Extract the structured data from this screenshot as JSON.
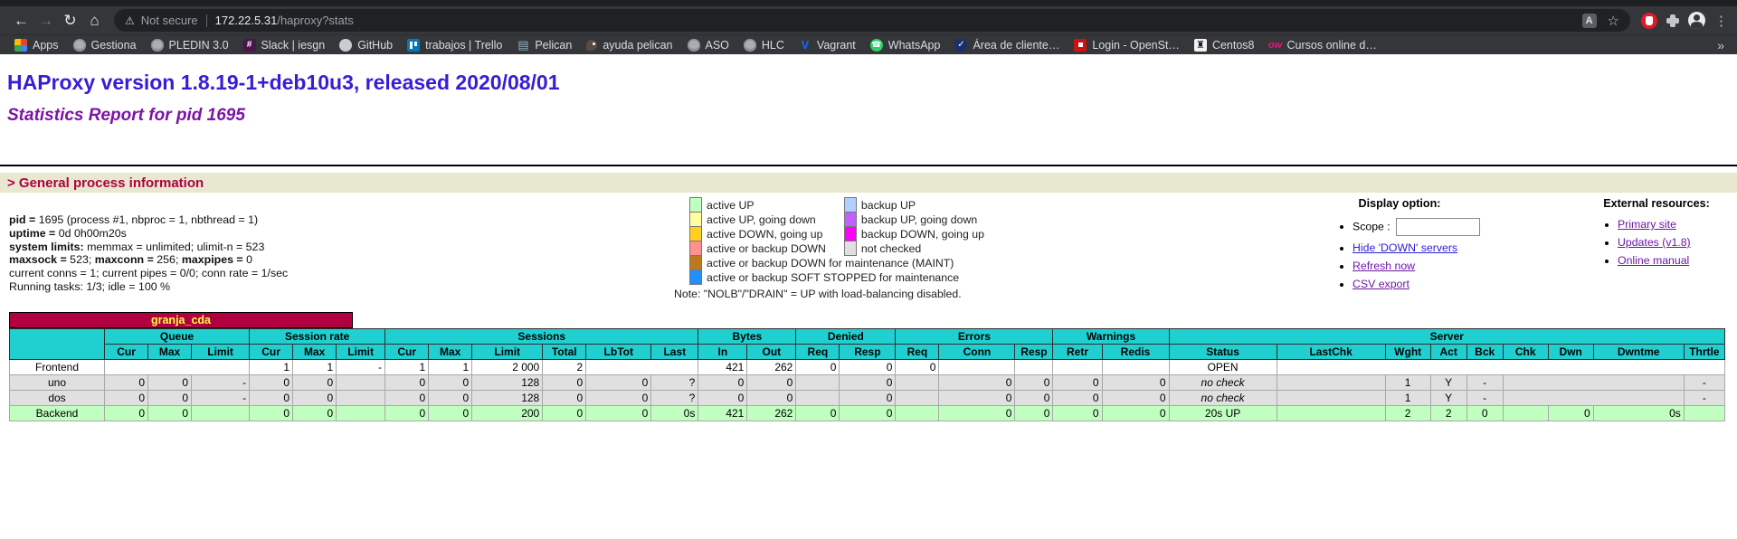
{
  "browser": {
    "security_label": "Not secure",
    "url_host": "172.22.5.31",
    "url_path": "/haproxy?stats",
    "overflow_chevron": "»",
    "bookmarks": [
      {
        "label": "Apps",
        "icon": "apps-grid"
      },
      {
        "label": "Gestiona",
        "icon": "globe"
      },
      {
        "label": "PLEDIN 3.0",
        "icon": "globe"
      },
      {
        "label": "Slack | iesgn",
        "icon": "slack"
      },
      {
        "label": "GitHub",
        "icon": "github"
      },
      {
        "label": "trabajos | Trello",
        "icon": "trello"
      },
      {
        "label": "Pelican",
        "icon": "pelican-site"
      },
      {
        "label": "ayuda pelican",
        "icon": "bird"
      },
      {
        "label": "ASO",
        "icon": "globe"
      },
      {
        "label": "HLC",
        "icon": "globe"
      },
      {
        "label": "Vagrant",
        "icon": "vagrant"
      },
      {
        "label": "WhatsApp",
        "icon": "whatsapp"
      },
      {
        "label": "Área de cliente…",
        "icon": "check-circle"
      },
      {
        "label": "Login - OpenSt…",
        "icon": "openstack"
      },
      {
        "label": "Centos8",
        "icon": "centos"
      },
      {
        "label": "Cursos online d…",
        "icon": "openwebinars"
      }
    ]
  },
  "page": {
    "h1": "HAProxy version 1.8.19-1+deb10u3, released 2020/08/01",
    "h2": "Statistics Report for pid 1695",
    "section_header": "> General process information",
    "process_info": [
      [
        {
          "t": "pid = ",
          "b": 1
        },
        {
          "t": "1695 (process #1, nbproc = 1, nbthread = 1)",
          "b": 0
        }
      ],
      [
        {
          "t": "uptime = ",
          "b": 1
        },
        {
          "t": "0d 0h00m20s",
          "b": 0
        }
      ],
      [
        {
          "t": "system limits:",
          "b": 1
        },
        {
          "t": " memmax = unlimited; ulimit-n = 523",
          "b": 0
        }
      ],
      [
        {
          "t": "maxsock = ",
          "b": 1
        },
        {
          "t": "523; ",
          "b": 0
        },
        {
          "t": "maxconn = ",
          "b": 1
        },
        {
          "t": "256; ",
          "b": 0
        },
        {
          "t": "maxpipes = ",
          "b": 1
        },
        {
          "t": "0",
          "b": 0
        }
      ],
      [
        {
          "t": "current conns = 1; current pipes = 0/0; conn rate = 1/sec",
          "b": 0
        }
      ],
      [
        {
          "t": "Running tasks: 1/3; idle = 100 %",
          "b": 0
        }
      ]
    ],
    "legend": {
      "pairs": [
        [
          {
            "color": "#c0ffc0",
            "label": "active UP"
          },
          {
            "color": "#b0d0ff",
            "label": "backup UP"
          }
        ],
        [
          {
            "color": "#ffffa0",
            "label": "active UP, going down"
          },
          {
            "color": "#c060ff",
            "label": "backup UP, going down"
          }
        ],
        [
          {
            "color": "#ffd020",
            "label": "active DOWN, going up"
          },
          {
            "color": "#ff00ff",
            "label": "backup DOWN, going up"
          }
        ],
        [
          {
            "color": "#ff9090",
            "label": "active or backup DOWN"
          },
          {
            "color": "#e0e0e0",
            "label": "not checked"
          }
        ],
        [
          {
            "color": "#c07820",
            "label": "active or backup DOWN for maintenance (MAINT)"
          },
          null
        ],
        [
          {
            "color": "#2090ff",
            "label": "active or backup SOFT STOPPED for maintenance"
          },
          null
        ]
      ],
      "note": "Note: \"NOLB\"/\"DRAIN\" = UP with load-balancing disabled."
    },
    "display_options": {
      "title": "Display option:",
      "scope_label": "Scope :",
      "links": [
        {
          "label": "Hide 'DOWN' servers",
          "color": "blue"
        },
        {
          "label": "Refresh now",
          "color": "purple"
        },
        {
          "label": "CSV export",
          "color": "purple"
        }
      ]
    },
    "external_resources": {
      "title": "External resources:",
      "links": [
        {
          "label": "Primary site",
          "color": "purple"
        },
        {
          "label": "Updates (v1.8)",
          "color": "purple"
        },
        {
          "label": "Online manual",
          "color": "purple"
        }
      ]
    }
  },
  "stats": {
    "proxy_name": "granja_cda",
    "header_groups": [
      {
        "label": "Queue",
        "span": 3
      },
      {
        "label": "Session rate",
        "span": 3
      },
      {
        "label": "Sessions",
        "span": 6
      },
      {
        "label": "Bytes",
        "span": 2
      },
      {
        "label": "Denied",
        "span": 2
      },
      {
        "label": "Errors",
        "span": 3
      },
      {
        "label": "Warnings",
        "span": 2
      },
      {
        "label": "Server",
        "span": 9
      }
    ],
    "columns": [
      "Cur",
      "Max",
      "Limit",
      "Cur",
      "Max",
      "Limit",
      "Cur",
      "Max",
      "Limit",
      "Total",
      "LbTot",
      "Last",
      "In",
      "Out",
      "Req",
      "Resp",
      "Req",
      "Conn",
      "Resp",
      "Retr",
      "Redis",
      "Status",
      "LastChk",
      "Wght",
      "Act",
      "Bck",
      "Chk",
      "Dwn",
      "Dwntme",
      "Thrtle"
    ],
    "rows": [
      {
        "name": "Frontend",
        "cls": "frontend",
        "cells": [
          {
            "v": "",
            "cs": 3
          },
          {
            "v": "1",
            "al": "r"
          },
          {
            "v": "1",
            "al": "r"
          },
          {
            "v": "-",
            "al": "r"
          },
          {
            "v": "1",
            "al": "r"
          },
          {
            "v": "1",
            "al": "r"
          },
          {
            "v": "2 000",
            "al": "r"
          },
          {
            "v": "2",
            "al": "r"
          },
          {
            "v": "",
            "cs": 2
          },
          {
            "v": "421",
            "al": "r"
          },
          {
            "v": "262",
            "al": "r"
          },
          {
            "v": "0",
            "al": "r"
          },
          {
            "v": "0",
            "al": "r"
          },
          {
            "v": "0",
            "al": "r"
          },
          {
            "v": ""
          },
          {
            "v": ""
          },
          {
            "v": ""
          },
          {
            "v": ""
          },
          {
            "v": "OPEN",
            "al": "c"
          },
          {
            "v": "",
            "cs": 8
          }
        ]
      },
      {
        "name": "uno",
        "cls": "nocheck",
        "cells": [
          {
            "v": "0",
            "al": "r"
          },
          {
            "v": "0",
            "al": "r"
          },
          {
            "v": "-",
            "al": "r"
          },
          {
            "v": "0",
            "al": "r"
          },
          {
            "v": "0",
            "al": "r"
          },
          {
            "v": ""
          },
          {
            "v": "0",
            "al": "r"
          },
          {
            "v": "0",
            "al": "r"
          },
          {
            "v": "128",
            "al": "r"
          },
          {
            "v": "0",
            "al": "r"
          },
          {
            "v": "0",
            "al": "r"
          },
          {
            "v": "?",
            "al": "r"
          },
          {
            "v": "0",
            "al": "r"
          },
          {
            "v": "0",
            "al": "r"
          },
          {
            "v": ""
          },
          {
            "v": "0",
            "al": "r"
          },
          {
            "v": ""
          },
          {
            "v": "0",
            "al": "r"
          },
          {
            "v": "0",
            "al": "r"
          },
          {
            "v": "0",
            "al": "r"
          },
          {
            "v": "0",
            "al": "r"
          },
          {
            "v": "no check",
            "al": "c",
            "it": 1
          },
          {
            "v": ""
          },
          {
            "v": "1",
            "al": "c"
          },
          {
            "v": "Y",
            "al": "c"
          },
          {
            "v": "-",
            "al": "c"
          },
          {
            "v": "",
            "cs": 3
          },
          {
            "v": "-",
            "al": "c"
          }
        ]
      },
      {
        "name": "dos",
        "cls": "nocheck",
        "cells": [
          {
            "v": "0",
            "al": "r"
          },
          {
            "v": "0",
            "al": "r"
          },
          {
            "v": "-",
            "al": "r"
          },
          {
            "v": "0",
            "al": "r"
          },
          {
            "v": "0",
            "al": "r"
          },
          {
            "v": ""
          },
          {
            "v": "0",
            "al": "r"
          },
          {
            "v": "0",
            "al": "r"
          },
          {
            "v": "128",
            "al": "r"
          },
          {
            "v": "0",
            "al": "r"
          },
          {
            "v": "0",
            "al": "r"
          },
          {
            "v": "?",
            "al": "r"
          },
          {
            "v": "0",
            "al": "r"
          },
          {
            "v": "0",
            "al": "r"
          },
          {
            "v": ""
          },
          {
            "v": "0",
            "al": "r"
          },
          {
            "v": ""
          },
          {
            "v": "0",
            "al": "r"
          },
          {
            "v": "0",
            "al": "r"
          },
          {
            "v": "0",
            "al": "r"
          },
          {
            "v": "0",
            "al": "r"
          },
          {
            "v": "no check",
            "al": "c",
            "it": 1
          },
          {
            "v": ""
          },
          {
            "v": "1",
            "al": "c"
          },
          {
            "v": "Y",
            "al": "c"
          },
          {
            "v": "-",
            "al": "c"
          },
          {
            "v": "",
            "cs": 3
          },
          {
            "v": "-",
            "al": "c"
          }
        ]
      },
      {
        "name": "Backend",
        "cls": "up",
        "cells": [
          {
            "v": "0",
            "al": "r"
          },
          {
            "v": "0",
            "al": "r"
          },
          {
            "v": ""
          },
          {
            "v": "0",
            "al": "r"
          },
          {
            "v": "0",
            "al": "r"
          },
          {
            "v": ""
          },
          {
            "v": "0",
            "al": "r"
          },
          {
            "v": "0",
            "al": "r"
          },
          {
            "v": "200",
            "al": "r"
          },
          {
            "v": "0",
            "al": "r"
          },
          {
            "v": "0",
            "al": "r"
          },
          {
            "v": "0s",
            "al": "r"
          },
          {
            "v": "421",
            "al": "r"
          },
          {
            "v": "262",
            "al": "r"
          },
          {
            "v": "0",
            "al": "r"
          },
          {
            "v": "0",
            "al": "r"
          },
          {
            "v": ""
          },
          {
            "v": "0",
            "al": "r"
          },
          {
            "v": "0",
            "al": "r"
          },
          {
            "v": "0",
            "al": "r"
          },
          {
            "v": "0",
            "al": "r"
          },
          {
            "v": "20s UP",
            "al": "c"
          },
          {
            "v": ""
          },
          {
            "v": "2",
            "al": "c"
          },
          {
            "v": "2",
            "al": "c"
          },
          {
            "v": "0",
            "al": "c"
          },
          {
            "v": ""
          },
          {
            "v": "0",
            "al": "r"
          },
          {
            "v": "0s",
            "al": "r"
          },
          {
            "v": ""
          }
        ]
      }
    ]
  }
}
